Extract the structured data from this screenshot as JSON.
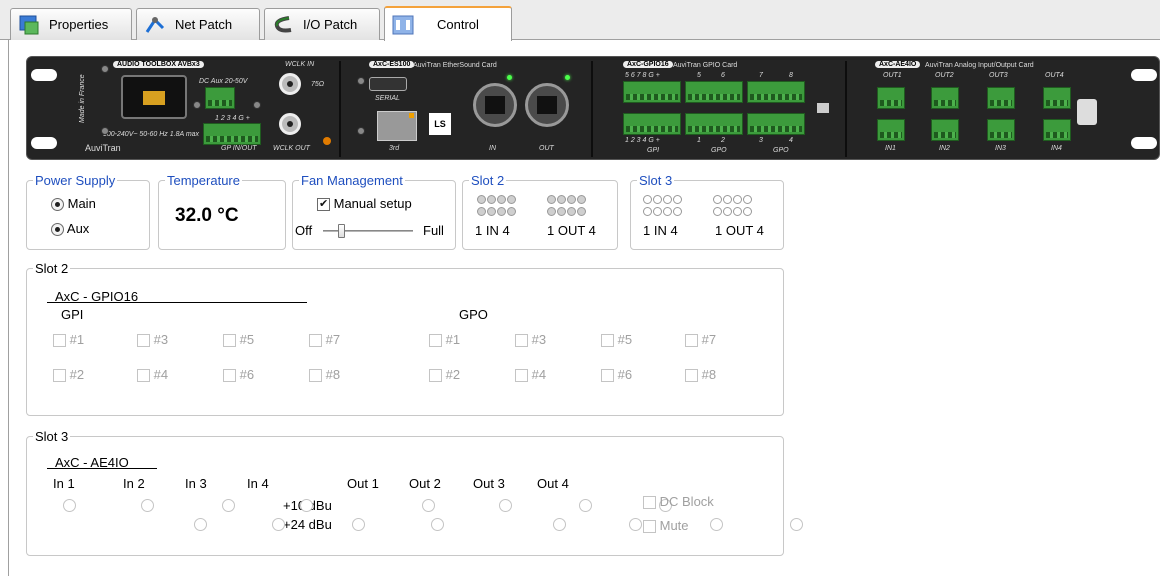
{
  "tabs": [
    {
      "label": "Properties",
      "icon": "properties-icon"
    },
    {
      "label": "Net Patch",
      "icon": "net-patch-icon"
    },
    {
      "label": "I/O Patch",
      "icon": "io-patch-icon"
    },
    {
      "label": "Control",
      "icon": "control-icon",
      "active": true
    }
  ],
  "device": {
    "main_label": "AUDIO TOOLBOX AVBx3",
    "dc_aux": "DC Aux 20-50V",
    "wclk_in": "WCLK IN",
    "wclk_out": "WCLK OUT",
    "ohm": "75Ω",
    "gp_io": "GP IN/OUT",
    "gp_nums": "1 2 3 4 G +",
    "made_in": "Made in France",
    "power_spec": "100-240V~ 50-60 Hz 1.8A max",
    "brand": "AuviTran",
    "card1_tag": "AxC-ES100",
    "card1_name": "AuviTran EtherSound Card",
    "card1_serial": "SERIAL",
    "card1_port3": "3rd",
    "card1_in": "IN",
    "card1_out": "OUT",
    "card2_tag": "AxC-GPIO16",
    "card2_name": "AuviTran GPIO Card",
    "card2_top_nums": "5 6 7 8 G +",
    "card2_top_5": "5",
    "card2_top_6": "6",
    "card2_top_7": "7",
    "card2_top_8": "8",
    "card2_bot_nums": "1 2 3 4 G +",
    "card2_bot_1": "1",
    "card2_bot_2": "2",
    "card2_bot_3": "3",
    "card2_bot_4": "4",
    "card2_gpi": "GPI",
    "card2_gpo": "GPO",
    "card3_tag": "AxC-AE4IO",
    "card3_name": "AuviTran Analog Input/Output Card",
    "card3_outs": [
      "OUT1",
      "OUT2",
      "OUT3",
      "OUT4"
    ],
    "card3_ins": [
      "IN1",
      "IN2",
      "IN3",
      "IN4"
    ]
  },
  "power_supply": {
    "title": "Power Supply",
    "options": [
      {
        "label": "Main",
        "selected": true
      },
      {
        "label": "Aux",
        "selected": true
      }
    ]
  },
  "temperature": {
    "title": "Temperature",
    "value": "32.0 °C"
  },
  "fan": {
    "title": "Fan Management",
    "manual_label": "Manual setup",
    "manual_checked": true,
    "min_label": "Off",
    "max_label": "Full",
    "level": 0.2
  },
  "slot2_leds": {
    "title": "Slot 2",
    "in_label": "1  IN  4",
    "out_label": "1 OUT 4",
    "state": "off"
  },
  "slot3_leds": {
    "title": "Slot 3",
    "in_label": "1  IN  4",
    "out_label": "1 OUT 4",
    "state": "dim"
  },
  "slot2": {
    "title": "Slot 2",
    "card": "AxC - GPIO16",
    "gpi_label": "GPI",
    "gpo_label": "GPO",
    "gpi": [
      "#1",
      "#3",
      "#5",
      "#7",
      "#2",
      "#4",
      "#6",
      "#8"
    ],
    "gpo": [
      "#1",
      "#3",
      "#5",
      "#7",
      "#2",
      "#4",
      "#6",
      "#8"
    ]
  },
  "slot3": {
    "title": "Slot 3",
    "card": "AxC - AE4IO",
    "inputs": [
      "In 1",
      "In 2",
      "In 3",
      "In 4"
    ],
    "outputs": [
      "Out 1",
      "Out 2",
      "Out 3",
      "Out 4"
    ],
    "levels": [
      "+10 dBu",
      "+24 dBu"
    ],
    "dc_block": "DC Block",
    "mute": "Mute"
  }
}
